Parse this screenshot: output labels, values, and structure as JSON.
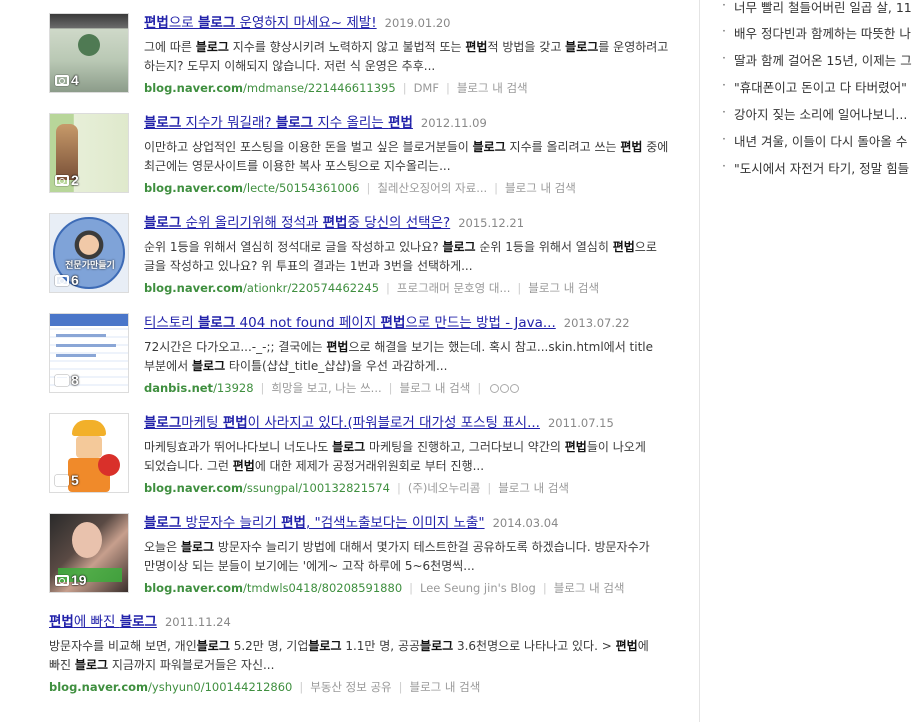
{
  "results": [
    {
      "title": [
        [
          "b",
          "편법"
        ],
        [
          "t",
          "으로 "
        ],
        [
          "b",
          "블로그"
        ],
        [
          "t",
          " 운영하지 마세요~ 제발!"
        ]
      ],
      "date": "2019.01.20",
      "desc": [
        [
          "t",
          "그에 따른 "
        ],
        [
          "b",
          "블로그"
        ],
        [
          "t",
          " 지수를 향상시키려 노력하지 않고 불법적 또는 "
        ],
        [
          "b",
          "편법"
        ],
        [
          "t",
          "적 방법을 갖고 "
        ],
        [
          "b",
          "블로그"
        ],
        [
          "t",
          "를 운영하려고 하는지? 도무지 이해되지 않습니다. 저런 식 운영은 추후..."
        ]
      ],
      "url_domain": "blog.naver.com",
      "url_path": "/mdmanse/221446611395",
      "source": "DMF",
      "blog_search": "블로그 내 검색",
      "photo_count": "4"
    },
    {
      "title": [
        [
          "b",
          "블로그"
        ],
        [
          "t",
          " 지수가 뭐길래? "
        ],
        [
          "b",
          "블로그"
        ],
        [
          "t",
          " 지수 올리는 "
        ],
        [
          "b",
          "편법"
        ]
      ],
      "date": "2012.11.09",
      "desc": [
        [
          "t",
          "이만하고 상업적인 포스팅을 이용한 돈을 벌고 싶은 블로거분들이 "
        ],
        [
          "b",
          "블로그"
        ],
        [
          "t",
          " 지수를 올리려고 쓰는 "
        ],
        [
          "b",
          "편법"
        ],
        [
          "t",
          " 중에 최근에는 영문사이트를 이용한 복사 포스팅으로 지수올리는..."
        ]
      ],
      "url_domain": "blog.naver.com",
      "url_path": "/lecte/50154361006",
      "source": "칠레산오징어의 자료...",
      "blog_search": "블로그 내 검색",
      "photo_count": "2"
    },
    {
      "title": [
        [
          "b",
          "블로그"
        ],
        [
          "t",
          " 순위 올리기위해 정석과 "
        ],
        [
          "b",
          "편법"
        ],
        [
          "t",
          "중 당신의 선택은?"
        ]
      ],
      "date": "2015.12.21",
      "desc": [
        [
          "t",
          "순위 1등을 위해서 열심히 정석대로 글을 작성하고 있나요? "
        ],
        [
          "b",
          "블로그"
        ],
        [
          "t",
          " 순위 1등을 위해서 열심히 "
        ],
        [
          "b",
          "편법"
        ],
        [
          "t",
          "으로 글을 작성하고 있나요? 위 투표의 결과는 1번과 3번을 선택하게..."
        ]
      ],
      "url_domain": "blog.naver.com",
      "url_path": "/ationkr/220574462245",
      "source": "프로그래머 문호영 대...",
      "blog_search": "블로그 내 검색",
      "photo_count": "6",
      "thumb_text": "전문가만들기"
    },
    {
      "title": [
        [
          "t",
          "티스토리 "
        ],
        [
          "b",
          "블로그"
        ],
        [
          "t",
          " 404 not found 페이지 "
        ],
        [
          "b",
          "편법"
        ],
        [
          "t",
          "으로 만드는 방법 - Java..."
        ]
      ],
      "date": "2013.07.22",
      "desc": [
        [
          "t",
          "72시간은 다가오고...-_-;; 결국에는 "
        ],
        [
          "b",
          "편법"
        ],
        [
          "t",
          "으로 해결을 보기는 했는데. 혹시 참고...skin.html에서 title 부분에서 "
        ],
        [
          "b",
          "블로그"
        ],
        [
          "t",
          " 타이틀(샵샵_title_샵샵)을 우선 과감하게..."
        ]
      ],
      "url_domain": "danbis.net",
      "url_path": "/13928",
      "source": "희망을 보고, 나는 쓰...",
      "blog_search": "블로그 내 검색",
      "photo_count": "8"
    },
    {
      "title": [
        [
          "b",
          "블로그"
        ],
        [
          "t",
          "마케팅 "
        ],
        [
          "b",
          "편법"
        ],
        [
          "t",
          "이 사라지고 있다.(파워블로거 대가성 포스팅 표시..."
        ]
      ],
      "date": "2011.07.15",
      "desc": [
        [
          "t",
          "마케팅효과가 뛰어나다보니 너도나도 "
        ],
        [
          "b",
          "블로그"
        ],
        [
          "t",
          " 마케팅을 진행하고, 그러다보니 약간의 "
        ],
        [
          "b",
          "편법"
        ],
        [
          "t",
          "들이 나오게 되었습니다. 그런 "
        ],
        [
          "b",
          "편법"
        ],
        [
          "t",
          "에 대한 제제가 공정거래위원회로 부터 진행..."
        ]
      ],
      "url_domain": "blog.naver.com",
      "url_path": "/ssungpal/100132821574",
      "source": "(주)네오누리콤",
      "blog_search": "블로그 내 검색",
      "photo_count": "5"
    },
    {
      "title": [
        [
          "b",
          "블로그"
        ],
        [
          "t",
          " 방문자수 늘리기 "
        ],
        [
          "b",
          "편법"
        ],
        [
          "t",
          ", \"검색노출보다는 이미지 노출\""
        ]
      ],
      "date": "2014.03.04",
      "desc": [
        [
          "t",
          "오늘은 "
        ],
        [
          "b",
          "블로그"
        ],
        [
          "t",
          " 방문자수 늘리기 방법에 대해서 몇가지 테스트한걸 공유하도록 하겠습니다. 방문자수가 만명이상 되는 분들이 보기에는 '에게~ 고작 하루에 5~6천명씩..."
        ]
      ],
      "url_domain": "blog.naver.com",
      "url_path": "/tmdwls0418/80208591880",
      "source": "Lee Seung jin's Blog",
      "blog_search": "블로그 내 검색",
      "photo_count": "19"
    },
    {
      "title": [
        [
          "b",
          "편법"
        ],
        [
          "t",
          "에 빠진 "
        ],
        [
          "b",
          "블로그"
        ]
      ],
      "date": "2011.11.24",
      "desc": [
        [
          "t",
          "방문자수를 비교해 보면, 개인"
        ],
        [
          "b",
          "블로그"
        ],
        [
          "t",
          " 5.2만 명, 기업"
        ],
        [
          "b",
          "블로그"
        ],
        [
          "t",
          " 1.1만 명, 공공"
        ],
        [
          "b",
          "블로그"
        ],
        [
          "t",
          " 3.6천명으로 나타나고 있다. > "
        ],
        [
          "b",
          "편법"
        ],
        [
          "t",
          "에 빠진 "
        ],
        [
          "b",
          "블로그"
        ],
        [
          "t",
          " 지금까지 파워블로거들은 자신..."
        ]
      ],
      "url_domain": "blog.naver.com",
      "url_path": "/yshyun0/100144212860",
      "source": "부동산 정보 공유",
      "blog_search": "블로그 내 검색"
    }
  ],
  "sidebar": {
    "links": [
      "너무 빨리 철들어버린 일곱 살, 11",
      "배우 정다빈과 함께하는 따뜻한 나",
      "딸과 함께 걸어온 15년, 이제는 그",
      "\"휴대폰이고 돈이고 다 타버렸어\"",
      "강아지 짖는 소리에 일어나보니...",
      "내년 겨울, 이들이 다시 돌아올 수",
      "\"도시에서 자전거 타기, 정말 힘들"
    ]
  },
  "colors": {
    "title": "#2222aa",
    "url": "#3f8f3f",
    "meta": "#999999"
  }
}
